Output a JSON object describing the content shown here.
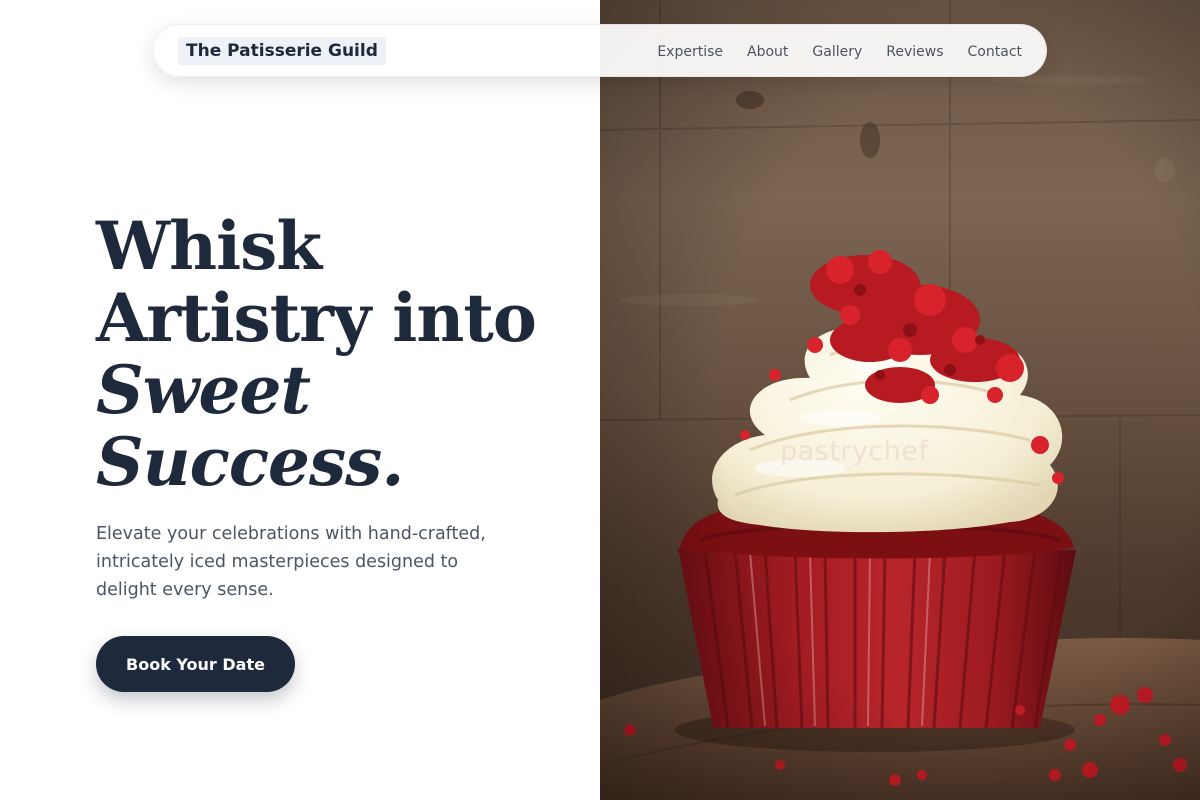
{
  "nav": {
    "brand": "The Patisserie Guild",
    "links": [
      "Expertise",
      "About",
      "Gallery",
      "Reviews",
      "Contact"
    ]
  },
  "hero": {
    "headline_line1": "Whisk",
    "headline_line2": "Artistry into",
    "headline_line3": "Sweet",
    "headline_line4": "Success.",
    "description": "Elevate your celebrations with hand-crafted, intricately iced masterpieces designed to delight every sense.",
    "cta_label": "Book Your Date"
  },
  "photo": {
    "subject": "red-velvet-cupcake",
    "watermark": "pastrychef"
  },
  "colors": {
    "primary": "#1e293b",
    "body_text": "#4b5563",
    "brand_bg": "#eef1f5",
    "background": "#ffffff"
  }
}
